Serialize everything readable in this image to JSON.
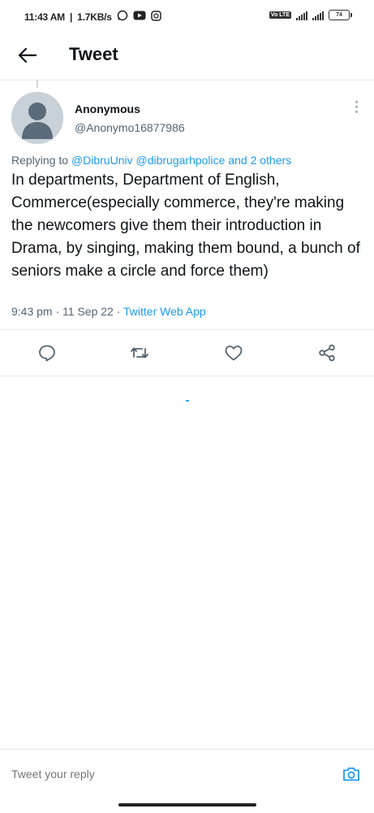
{
  "status_bar": {
    "time": "11:43 AM",
    "net_speed": "1.7KB/s",
    "volte": "Vo LTE",
    "battery": "74"
  },
  "header": {
    "title": "Tweet"
  },
  "tweet": {
    "display_name": "Anonymous",
    "handle": "@Anonymo16877986",
    "replying_prefix": "Replying to",
    "replying_to": "@DibruUniv @dibrugarhpolice and 2 others",
    "text": "In departments, Department of English, Commerce(especially commerce, they're making the newcomers give them their introduction in Drama, by singing, making them bound, a bunch of seniors make a circle and force them)",
    "timestamp": "9:43 pm · 11 Sep 22 · ",
    "source": "Twitter Web App"
  },
  "actions": {
    "reply": "reply-icon",
    "retweet": "retweet-icon",
    "like": "heart-icon",
    "share": "share-icon"
  },
  "reply_bar": {
    "placeholder": "Tweet your reply"
  },
  "colors": {
    "accent": "#1d9bf0",
    "text": "#0f1419",
    "muted": "#536471",
    "divider": "#e6ecf0"
  }
}
